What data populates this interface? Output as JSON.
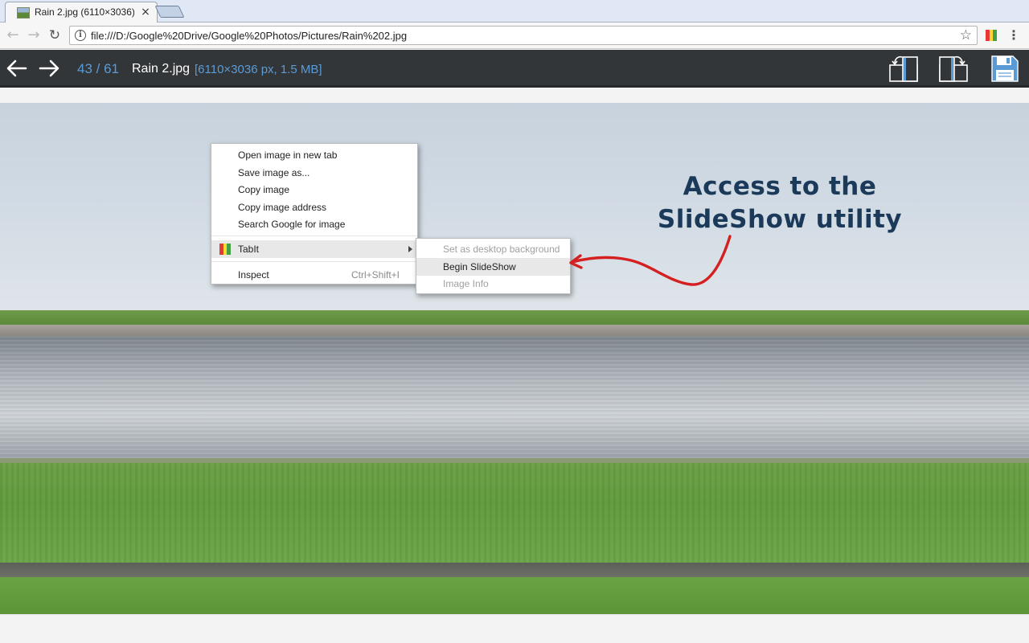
{
  "browser": {
    "tab": {
      "title": "Rain 2.jpg (6110×3036) |",
      "close": "×",
      "favicon": "image-thumbnail-icon"
    },
    "newtab_icon": "new-tab-icon",
    "nav": {
      "back": "←",
      "forward": "→",
      "reload": "↻"
    },
    "address": "file:///D:/Google%20Drive/Google%20Photos/Pictures/Rain%202.jpg",
    "info_icon": "i",
    "star": "☆",
    "menu": "⋮"
  },
  "viewer": {
    "counter": "43 / 61",
    "filename": "Rain 2.jpg",
    "fileinfo": "[6110×3036 px, 1.5 MB]",
    "icons": [
      "arrow-left-icon",
      "arrow-right-icon",
      "rotate-left-icon",
      "rotate-right-icon",
      "save-icon"
    ]
  },
  "context_menu": {
    "items": [
      "Open image in new tab",
      "Save image as...",
      "Copy image",
      "Copy image address",
      "Search Google for image"
    ],
    "tabit": "TabIt",
    "inspect": "Inspect",
    "inspect_shortcut": "Ctrl+Shift+I"
  },
  "submenu": {
    "items": [
      "Set as desktop background",
      "Begin SlideShow",
      "Image Info"
    ]
  },
  "annotation": {
    "line1": "Access to the",
    "line2": "SlideShow utility"
  },
  "colors": {
    "accent_blue": "#5b9bd5",
    "viewer_bar": "#333638",
    "annotation": "#1b3a5a",
    "arrow_red": "#d42020",
    "tabit_colors": [
      "#e53935",
      "#fdd835",
      "#43a047"
    ]
  }
}
